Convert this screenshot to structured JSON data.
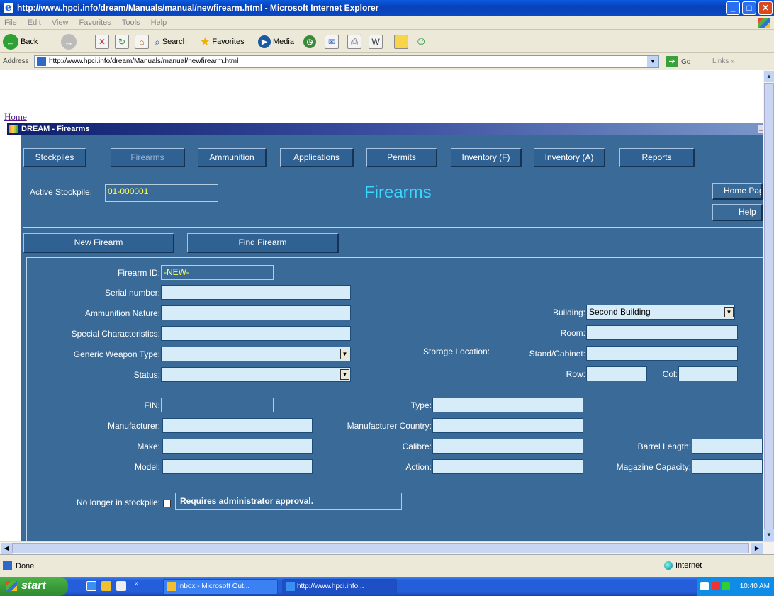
{
  "window": {
    "title": "http://www.hpci.info/dream/Manuals/manual/newfirearm.html - Microsoft Internet Explorer",
    "min_label": "_",
    "max_label": "□",
    "close_label": "✕"
  },
  "menubar": [
    "File",
    "Edit",
    "View",
    "Favorites",
    "Tools",
    "Help"
  ],
  "toolbar": {
    "back": "Back",
    "search": "Search",
    "favorites": "Favorites",
    "media": "Media"
  },
  "address": {
    "label": "Address",
    "url": "http://www.hpci.info/dream/Manuals/manual/newfirearm.html",
    "go": "Go",
    "links": "Links"
  },
  "page": {
    "home_link": "Home"
  },
  "app": {
    "title": "DREAM - Firearms",
    "nav": [
      "Stockpiles",
      "Firearms",
      "Ammunition",
      "Applications",
      "Permits",
      "Inventory (F)",
      "Inventory (A)",
      "Reports"
    ],
    "active_nav": "Firearms",
    "active_stockpile_label": "Active Stockpile:",
    "active_stockpile_value": "01-000001",
    "heading": "Firearms",
    "home_page_btn": "Home Page",
    "help_btn": "Help",
    "new_firearm_btn": "New Firearm",
    "find_firearm_btn": "Find Firearm",
    "fields": {
      "firearm_id_label": "Firearm ID:",
      "firearm_id_value": "-NEW-",
      "serial_label": "Serial number:",
      "ammo_nature_label": "Ammunition Nature:",
      "special_char_label": "Special Characteristics:",
      "generic_type_label": "Generic Weapon Type:",
      "status_label": "Status:",
      "storage_location_label": "Storage Location:",
      "building_label": "Building:",
      "building_value": "Second Building",
      "room_label": "Room:",
      "stand_label": "Stand/Cabinet:",
      "row_label": "Row:",
      "col_label": "Col:",
      "fin_label": "FIN:",
      "manufacturer_label": "Manufacturer:",
      "make_label": "Make:",
      "model_label": "Model:",
      "type_label": "Type:",
      "manufacturer_country_label": "Manufacturer Country:",
      "calibre_label": "Calibre:",
      "action_label": "Action:",
      "barrel_length_label": "Barrel Length:",
      "magazine_capacity_label": "Magazine Capacity:",
      "no_longer_label": "No longer in stockpile:",
      "approval_text": "Requires administrator approval."
    }
  },
  "statusbar": {
    "status": "Done",
    "zone": "Internet"
  },
  "taskbar": {
    "start": "start",
    "tasks": [
      "Inbox - Microsoft Out...",
      "http://www.hpci.info..."
    ],
    "clock": "10:40 AM"
  }
}
